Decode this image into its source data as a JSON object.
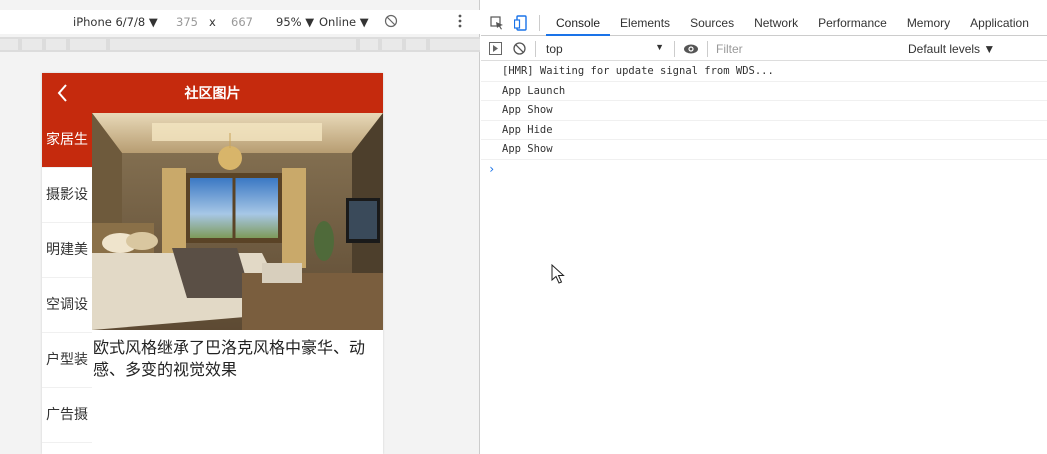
{
  "device_toolbar": {
    "device": "iPhone 6/7/8 ▼",
    "width": "375",
    "times": "x",
    "height": "667",
    "zoom": "95% ▼",
    "network": "Online ▼"
  },
  "phone": {
    "title": "社区图片",
    "categories": [
      "家居生",
      "摄影设",
      "明建美",
      "空调设",
      "户型装",
      "广告摄"
    ],
    "active_category_index": 0,
    "description": "欧式风格继承了巴洛克风格中豪华、动感、多变的视觉效果",
    "accent_color": "#c52a0d"
  },
  "devtools": {
    "tabs": [
      "Console",
      "Elements",
      "Sources",
      "Network",
      "Performance",
      "Memory",
      "Application"
    ],
    "active_tab": "Console",
    "context": "top",
    "filter_placeholder": "Filter",
    "levels": "Default levels ▼",
    "console_lines": [
      "[HMR] Waiting for update signal from WDS...",
      "App Launch",
      "App Show",
      "App Hide",
      "App Show"
    ],
    "prompt": "›"
  }
}
